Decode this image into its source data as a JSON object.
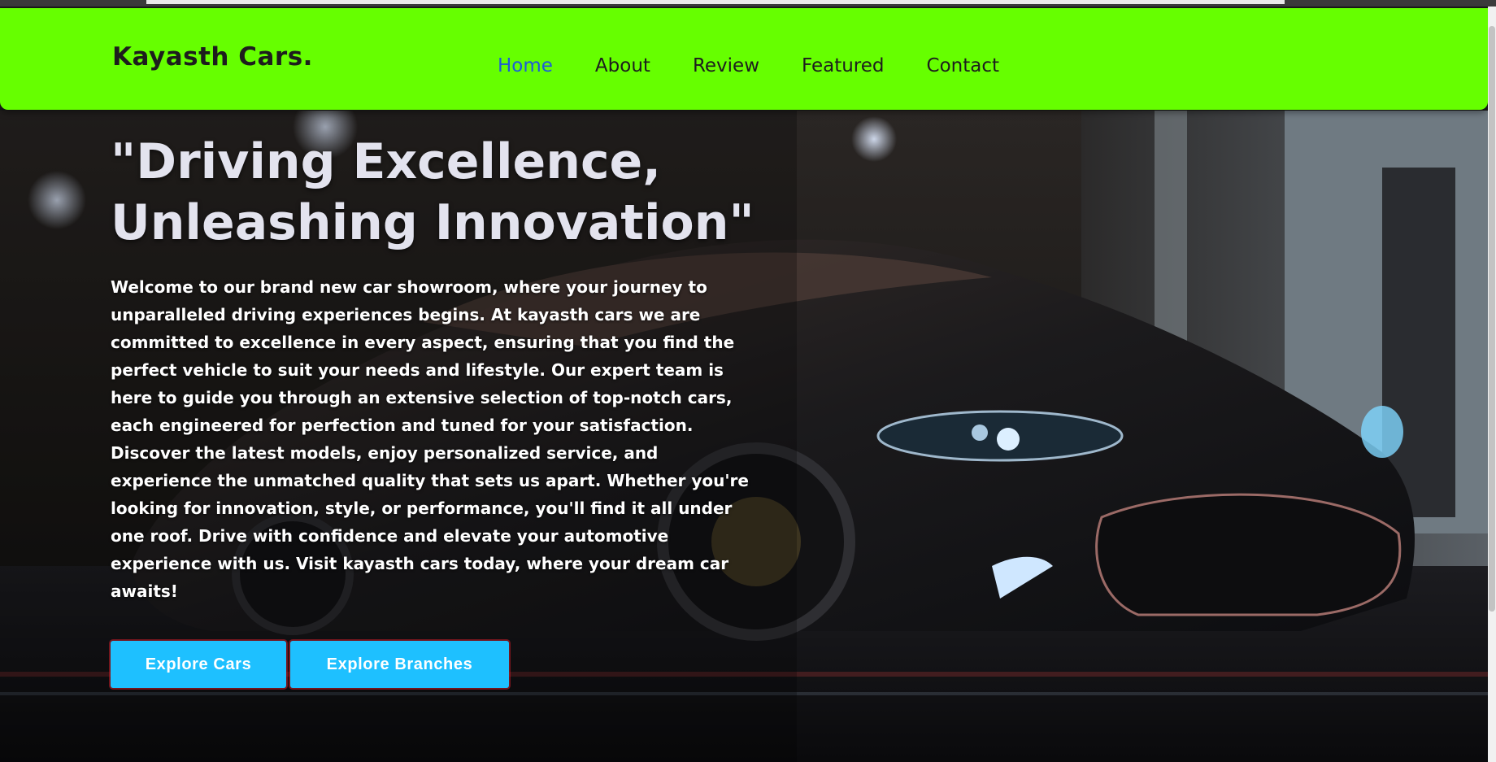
{
  "brand": {
    "name": "Kayasth Cars."
  },
  "nav": {
    "items": [
      {
        "label": "Home",
        "active": true
      },
      {
        "label": "About"
      },
      {
        "label": "Review"
      },
      {
        "label": "Featured"
      },
      {
        "label": "Contact"
      }
    ]
  },
  "hero": {
    "headline": "\"Driving Excellence, Unleashing Innovation\"",
    "intro": "Welcome to our brand new car showroom, where your journey to unparalleled driving experiences begins. At kayasth cars we are committed to excellence in every aspect, ensuring that you find the perfect vehicle to suit your needs and lifestyle. Our expert team is here to guide you through an extensive selection of top-notch cars, each engineered for perfection and tuned for your satisfaction. Discover the latest models, enjoy personalized service, and experience the unmatched quality that sets us apart. Whether you're looking for innovation, style, or performance, you'll find it all under one roof. Drive with confidence and elevate your automotive experience with us. Visit kayasth cars today, where your dream car awaits!",
    "buttons": {
      "explore_cars": "Explore Cars",
      "explore_branches": "Explore Branches"
    },
    "background_image": "dark sports car on rainy night street"
  },
  "colors": {
    "navbar": "#66ff00",
    "active_link": "#1e5bd8",
    "button": "#1ec0ff",
    "headline": "#e3e3ee"
  }
}
